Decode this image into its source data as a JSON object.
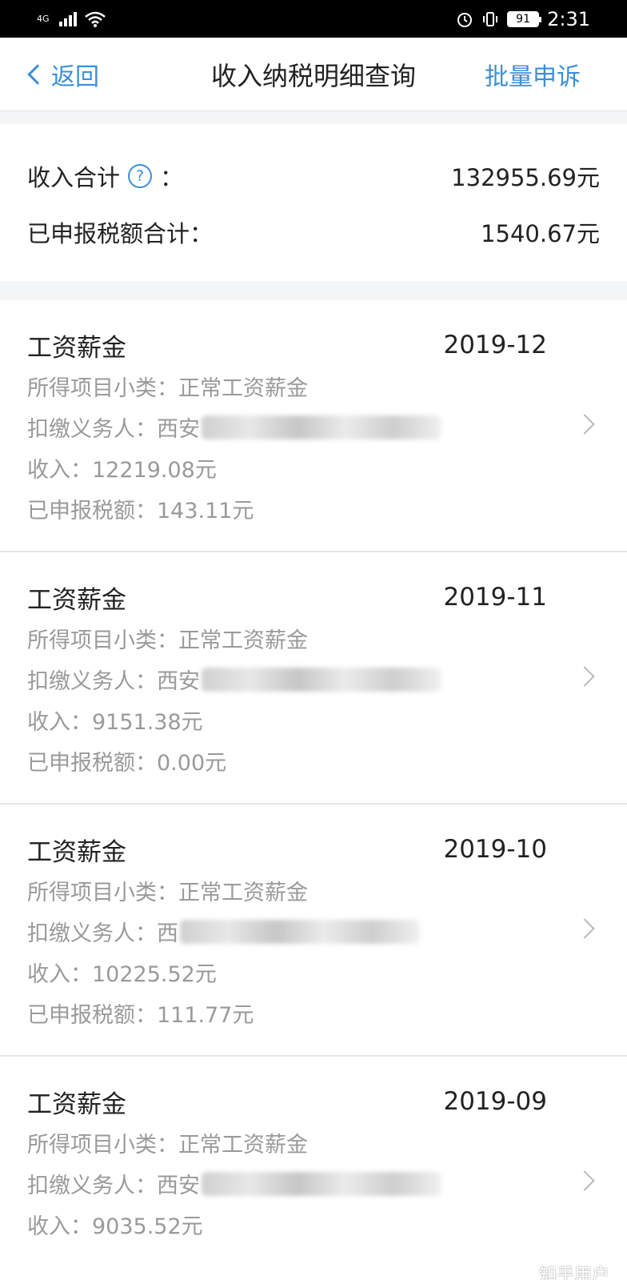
{
  "status_bar": {
    "network": "4G",
    "battery": "91",
    "time": "2:31"
  },
  "nav": {
    "back_label": "返回",
    "title": "收入纳税明细查询",
    "action_label": "批量申诉"
  },
  "summary": {
    "income_label": "收入合计",
    "income_colon": "：",
    "income_value": "132955.69元",
    "tax_label": "已申报税额合计：",
    "tax_value": "1540.67元",
    "help_glyph": "?"
  },
  "records": [
    {
      "type": "工资薪金",
      "period": "2019-12",
      "subcategory": "所得项目小类：正常工资薪金",
      "withholder_label": "扣缴义务人：西安",
      "income": "收入：12219.08元",
      "tax": "已申报税额：143.11元"
    },
    {
      "type": "工资薪金",
      "period": "2019-11",
      "subcategory": "所得项目小类：正常工资薪金",
      "withholder_label": "扣缴义务人：西安",
      "income": "收入：9151.38元",
      "tax": "已申报税额：0.00元"
    },
    {
      "type": "工资薪金",
      "period": "2019-10",
      "subcategory": "所得项目小类：正常工资薪金",
      "withholder_label": "扣缴义务人：西",
      "income": "收入：10225.52元",
      "tax": "已申报税额：111.77元"
    },
    {
      "type": "工资薪金",
      "period": "2019-09",
      "subcategory": "所得项目小类：正常工资薪金",
      "withholder_label": "扣缴义务人：西安",
      "income": "收入：9035.52元",
      "tax": ""
    }
  ],
  "watermark": "知乎用户",
  "colors": {
    "accent": "#3b8fd9",
    "muted_text": "#9a9a9a",
    "page_bg": "#f4f5f7"
  }
}
